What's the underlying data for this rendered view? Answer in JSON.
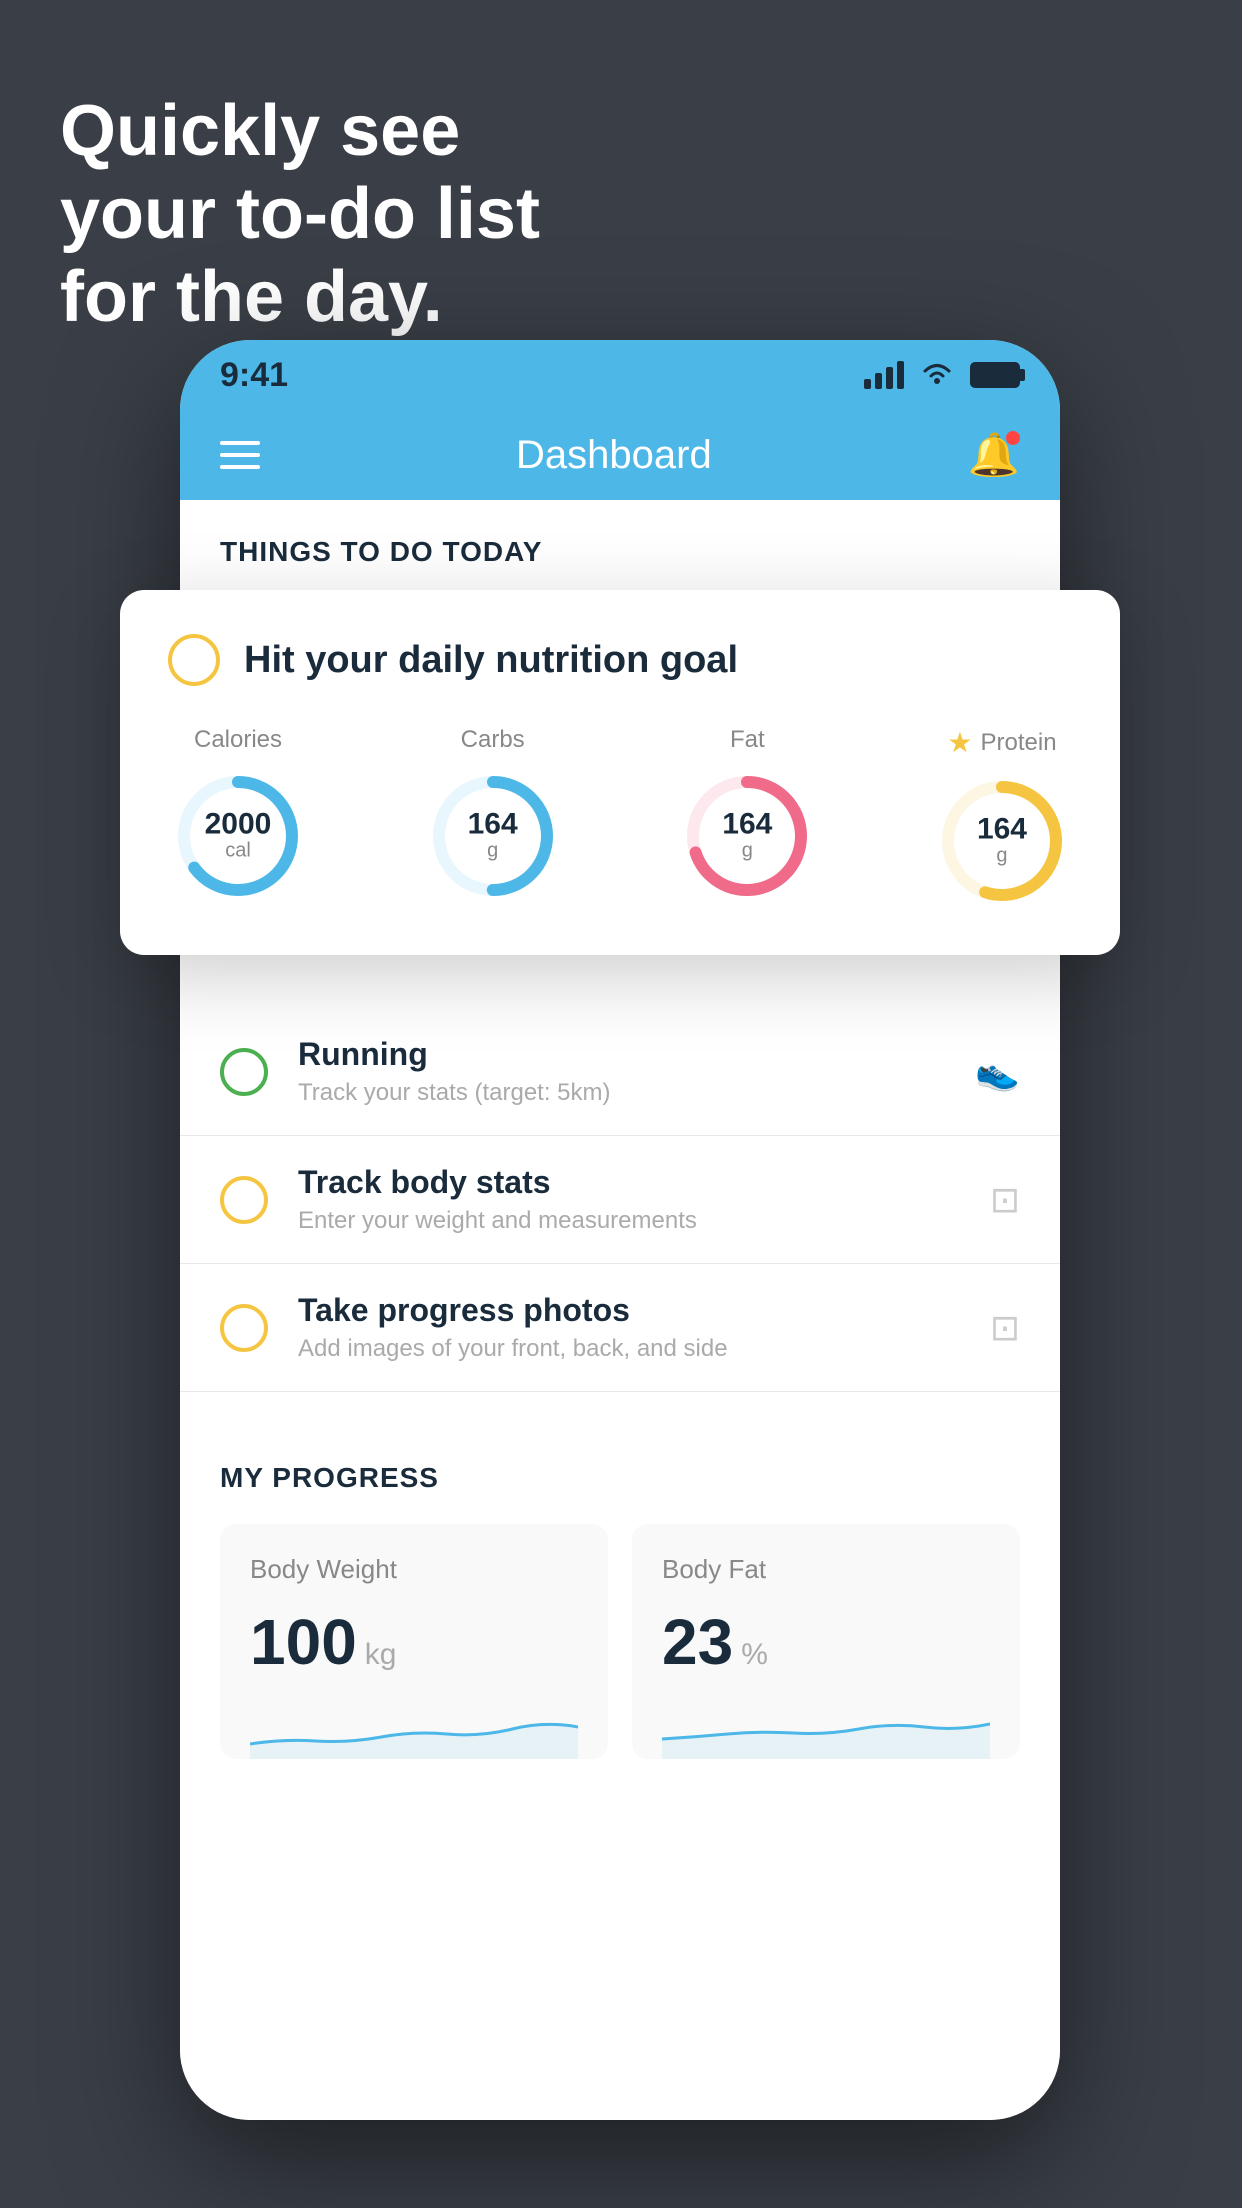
{
  "headline": {
    "line1": "Quickly see",
    "line2": "your to-do list",
    "line3": "for the day."
  },
  "status_bar": {
    "time": "9:41"
  },
  "nav": {
    "title": "Dashboard"
  },
  "things_section": {
    "header": "THINGS TO DO TODAY"
  },
  "nutrition_card": {
    "title": "Hit your daily nutrition goal",
    "macros": [
      {
        "label": "Calories",
        "value": "2000",
        "unit": "cal",
        "color": "#4db8e8",
        "track_color": "#e8f7fd",
        "pct": 65
      },
      {
        "label": "Carbs",
        "value": "164",
        "unit": "g",
        "color": "#4db8e8",
        "track_color": "#e8f7fd",
        "pct": 50
      },
      {
        "label": "Fat",
        "value": "164",
        "unit": "g",
        "color": "#f06a8a",
        "track_color": "#fde8ee",
        "pct": 70
      },
      {
        "label": "Protein",
        "value": "164",
        "unit": "g",
        "color": "#f5c542",
        "track_color": "#fdf6e3",
        "pct": 55,
        "starred": true
      }
    ]
  },
  "todo_items": [
    {
      "id": "running",
      "label": "Running",
      "sub": "Track your stats (target: 5km)",
      "circle_color": "green",
      "icon": "👟"
    },
    {
      "id": "body-stats",
      "label": "Track body stats",
      "sub": "Enter your weight and measurements",
      "circle_color": "yellow",
      "icon": "⚖️"
    },
    {
      "id": "progress-photos",
      "label": "Take progress photos",
      "sub": "Add images of your front, back, and side",
      "circle_color": "yellow",
      "icon": "🖼️"
    }
  ],
  "progress": {
    "header": "MY PROGRESS",
    "cards": [
      {
        "id": "body-weight",
        "title": "Body Weight",
        "value": "100",
        "unit": "kg"
      },
      {
        "id": "body-fat",
        "title": "Body Fat",
        "value": "23",
        "unit": "%"
      }
    ]
  }
}
